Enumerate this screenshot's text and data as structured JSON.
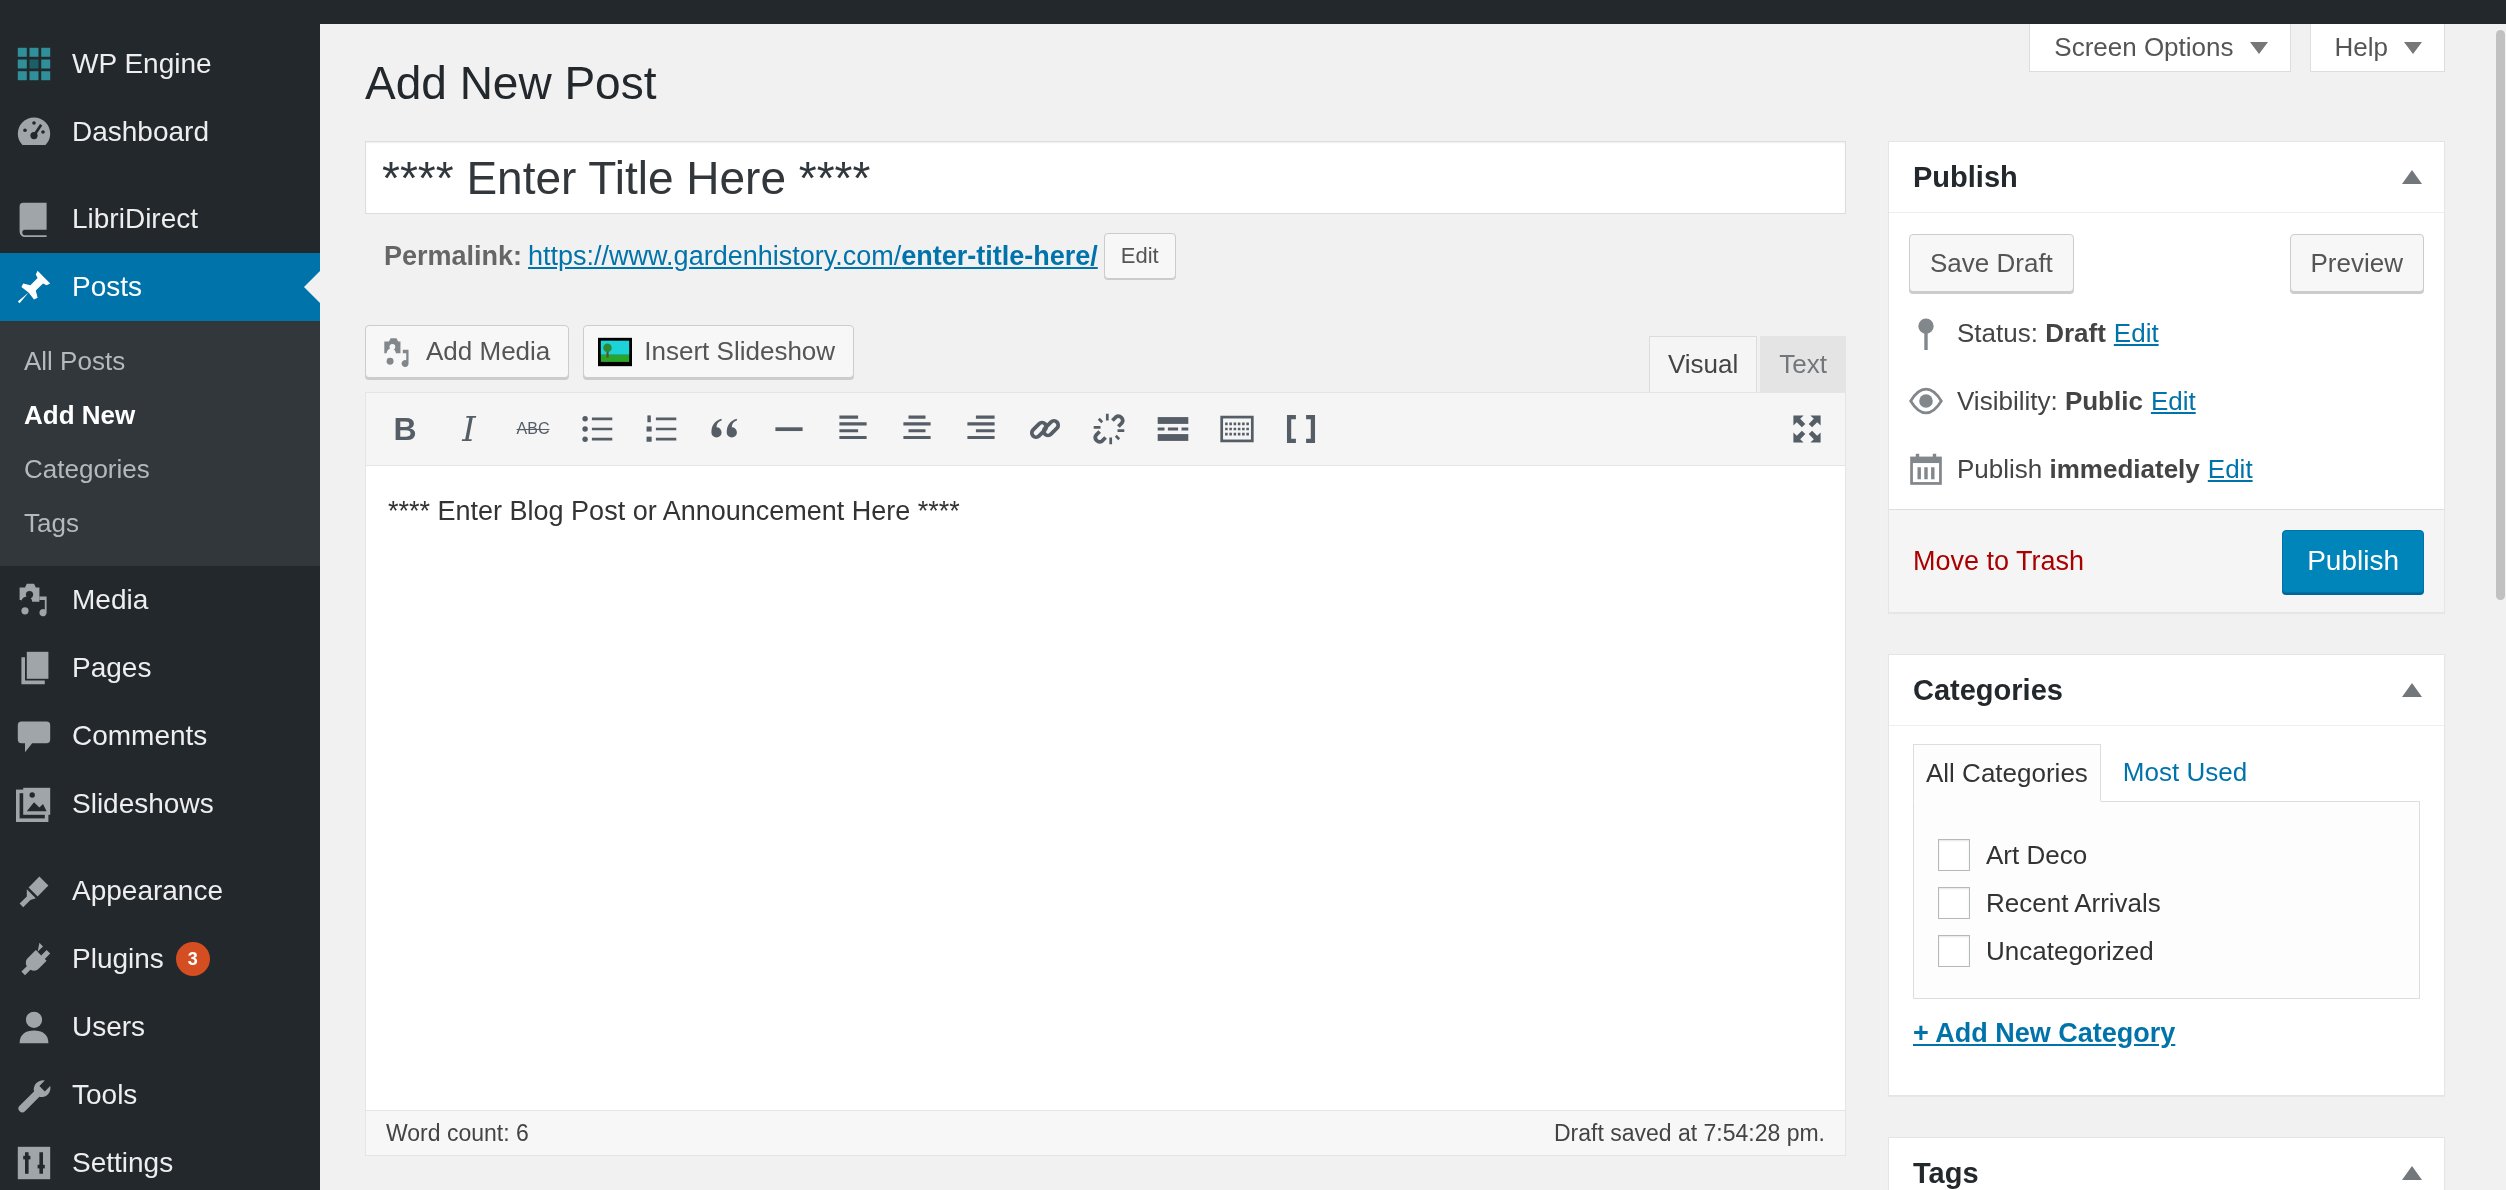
{
  "sidebar": {
    "groups": [
      [
        {
          "kind": "engine",
          "label": "WP Engine",
          "selected": false
        },
        {
          "kind": "dashboard",
          "label": "Dashboard",
          "selected": false
        }
      ],
      [
        {
          "kind": "books",
          "label": "LibriDirect",
          "selected": false
        },
        {
          "kind": "posts",
          "label": "Posts",
          "selected": true,
          "children": [
            {
              "label": "All Posts",
              "selected": false
            },
            {
              "label": "Add New",
              "selected": true
            },
            {
              "label": "Categories",
              "selected": false
            },
            {
              "label": "Tags",
              "selected": false
            }
          ]
        },
        {
          "kind": "media",
          "label": "Media",
          "selected": false
        },
        {
          "kind": "pages",
          "label": "Pages",
          "selected": false
        },
        {
          "kind": "comments",
          "label": "Comments",
          "selected": false
        },
        {
          "kind": "slideshows",
          "label": "Slideshows",
          "selected": false
        }
      ],
      [
        {
          "kind": "appearance",
          "label": "Appearance",
          "selected": false
        },
        {
          "kind": "plugins",
          "label": "Plugins",
          "selected": false,
          "badge": "3"
        },
        {
          "kind": "users",
          "label": "Users",
          "selected": false
        },
        {
          "kind": "tools",
          "label": "Tools",
          "selected": false
        },
        {
          "kind": "settings",
          "label": "Settings",
          "selected": false
        }
      ]
    ]
  },
  "page_title": "Add New Post",
  "screen_buttons": [
    "Screen Options",
    "Help"
  ],
  "title_field": {
    "value": "**** Enter Title Here ****"
  },
  "permalink": {
    "label": "Permalink:",
    "link": "https://www.gardenhistory.com/**enter-title-here/**",
    "button": "Edit"
  },
  "media_buttons": [
    {
      "kind": "media",
      "label": "Add Media"
    },
    {
      "kind": "slideshow",
      "label": "Insert Slideshow"
    }
  ],
  "editor_tabs": [
    {
      "label": "Visual",
      "selected": true
    },
    {
      "label": "Text",
      "selected": false
    }
  ],
  "toolbar": [
    {
      "kind": "bold",
      "glyph": "B"
    },
    {
      "kind": "italic",
      "glyph": "I"
    },
    {
      "kind": "strikethrough",
      "glyph": "ABC"
    },
    {
      "kind": "bullet-list"
    },
    {
      "kind": "numbered-list"
    },
    {
      "kind": "quote"
    },
    {
      "kind": "hr"
    },
    {
      "kind": "align-left"
    },
    {
      "kind": "align-center"
    },
    {
      "kind": "align-right"
    },
    {
      "kind": "link"
    },
    {
      "kind": "unlink"
    },
    {
      "kind": "more"
    },
    {
      "kind": "kitchen-sink"
    },
    {
      "kind": "brackets"
    },
    {
      "kind": "fullscreen"
    }
  ],
  "editor": {
    "content": "**** Enter Blog Post or Announcement Here ****",
    "word_count": "Word count: 6",
    "draft_saved": "Draft saved at 7:54:28 pm."
  },
  "publish": {
    "title": "Publish",
    "expanded": true,
    "buttons": [
      "Save Draft",
      "Preview"
    ],
    "rows": [
      {
        "kind": "status",
        "text": "Status: **Draft**",
        "link": "Edit"
      },
      {
        "kind": "visibility",
        "text": "Visibility: **Public**",
        "link": "Edit"
      },
      {
        "kind": "schedule",
        "text": "Publish **immediately**",
        "link": "Edit"
      }
    ],
    "trash": "Move to Trash",
    "publish_button": "Publish"
  },
  "categories": {
    "title": "Categories",
    "expanded": true,
    "tabs": [
      {
        "label": "All Categories",
        "selected": true
      },
      {
        "label": "Most Used",
        "selected": false
      }
    ],
    "items": [
      {
        "label": "Art Deco",
        "checked": false
      },
      {
        "label": "Recent Arrivals",
        "checked": false
      },
      {
        "label": "Uncategorized",
        "checked": false
      }
    ],
    "add_link": "+ Add New Category"
  },
  "tags": {
    "title": "Tags",
    "expanded": true
  }
}
